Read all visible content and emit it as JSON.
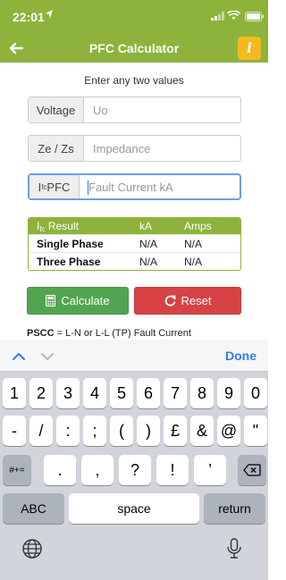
{
  "status_bar": {
    "time": "22:01"
  },
  "nav": {
    "title": "PFC Calculator",
    "info_label": "i"
  },
  "instruction": "Enter any two values",
  "fields": [
    {
      "label": "Voltage",
      "placeholder": "Uo"
    },
    {
      "label": "Ze / Zs",
      "placeholder": "Impedance"
    },
    {
      "label_main": "I",
      "label_sub": "fc",
      "label_rest": " PFC",
      "placeholder": "Fault Current kA"
    }
  ],
  "results": {
    "header": {
      "label_main": "I",
      "label_sub": "fc",
      "label_rest": " Result",
      "col_ka": "kA",
      "col_amps": "Amps"
    },
    "rows": [
      {
        "label": "Single Phase",
        "ka": "N/A",
        "amps": "N/A"
      },
      {
        "label": "Three Phase",
        "ka": "N/A",
        "amps": "N/A"
      }
    ]
  },
  "buttons": {
    "calculate": "Calculate",
    "reset": "Reset"
  },
  "note": {
    "bold": "PSCC",
    "text": " = L-N or L-L (TP) Fault Current"
  },
  "keyboard": {
    "done": "Done",
    "row1": [
      "1",
      "2",
      "3",
      "4",
      "5",
      "6",
      "7",
      "8",
      "9",
      "0"
    ],
    "row2": [
      "-",
      "/",
      ":",
      ";",
      "(",
      ")",
      "£",
      "&",
      "@",
      "\""
    ],
    "row3_left": "#+=",
    "row3": [
      ".",
      ",",
      "?",
      "!",
      "’"
    ],
    "abc": "ABC",
    "space": "space",
    "return": "return"
  },
  "colors": {
    "brand_green": "#8db33c",
    "info_yellow": "#f4b920",
    "calc_green": "#52a550",
    "reset_red": "#d74345",
    "link_blue": "#2f7cf6"
  }
}
